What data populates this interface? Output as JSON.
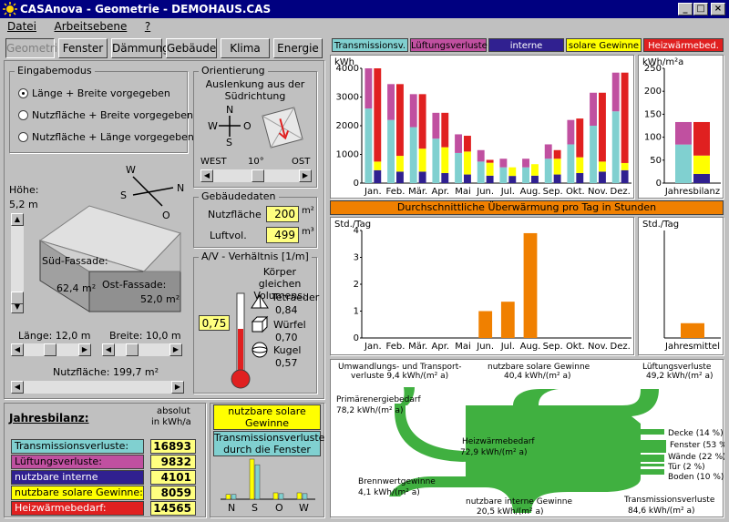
{
  "window": {
    "title": "CASAnova - Geometrie - DEMOHAUS.CAS"
  },
  "menu": [
    "Datei",
    "Arbeitsebene",
    "?"
  ],
  "tabs": [
    "Geometrie",
    "Fenster",
    "Dämmung",
    "Gebäude",
    "Klima",
    "Energie"
  ],
  "eingabemodus": {
    "label": "Eingabemodus",
    "options": [
      "Länge + Breite vorgegeben",
      "Nutzfläche + Breite  vorgegeben",
      "Nutzfläche + Länge vorgegeben"
    ],
    "selected": 0
  },
  "orientierung": {
    "label": "Orientierung",
    "text": "Auslenkung aus der Südrichtung",
    "compass": {
      "n": "N",
      "s": "S",
      "w": "W",
      "o": "O"
    },
    "west": "WEST",
    "value": "10°",
    "ost": "OST"
  },
  "gebaeudedaten": {
    "label": "Gebäudedaten",
    "nutzflaeche_label": "Nutzfläche",
    "nutzflaeche": "200",
    "nutzflaeche_unit": "m²",
    "luftvol_label": "Luftvol.",
    "luftvol": "499",
    "luftvol_unit": "m³"
  },
  "av": {
    "label": "A/V - Verhältnis [1/m]",
    "intro": "Körper gleichen Volumens:",
    "value": "0,75",
    "shapes": [
      {
        "name": "Tetraeder",
        "value": "0,84"
      },
      {
        "name": "Würfel",
        "value": "0,70"
      },
      {
        "name": "Kugel",
        "value": "0,57"
      }
    ],
    "fill_fraction": 0.55
  },
  "geometry": {
    "hoehe_label": "Höhe:",
    "hoehe": "5,2 m",
    "compass": {
      "w": "W",
      "s": "S",
      "n": "N",
      "o": "O"
    },
    "sued_fassade": "Süd-Fassade:",
    "sued_value": "62,4 m²",
    "ost_fassade": "Ost-Fassade:",
    "ost_value": "52,0 m²",
    "laenge": "Länge: 12,0 m",
    "breite": "Breite: 10,0 m",
    "nutzflaeche": "Nutzfläche: 199,7 m²"
  },
  "jahresbilanz": {
    "title": "Jahresbilanz:",
    "unit1": "absolut",
    "unit2": "in kWh/a",
    "rows": [
      {
        "label": "Transmissionsverluste:",
        "value": "16893",
        "color": "#80d0d0"
      },
      {
        "label": "Lüftungsverluste:",
        "value": "9832",
        "color": "#c050a0"
      },
      {
        "label": "nutzbare interne Gewinne:",
        "value": "4101",
        "color": "#302090"
      },
      {
        "label": "nutzbare solare Gewinne:",
        "value": "8059",
        "color": "#ffff00"
      },
      {
        "label": "Heizwärmebedarf:",
        "value": "14565",
        "color": "#e02020"
      }
    ]
  },
  "solar_panel": {
    "legend1": "nutzbare solare Gewinne",
    "legend2": "Transmissionsverluste durch die Fenster",
    "categories": [
      "N",
      "S",
      "O",
      "W"
    ],
    "solar": [
      0.12,
      1.0,
      0.16,
      0.16
    ],
    "trans": [
      0.12,
      0.86,
      0.14,
      0.14
    ]
  },
  "legend": [
    {
      "label": "Transmissionsv.",
      "color": "#80d0d0",
      "text": "#000000"
    },
    {
      "label": "Lüftungsverluste",
      "color": "#c050a0",
      "text": "#000000"
    },
    {
      "label": "interne Gewinne",
      "color": "#302090",
      "text": "#ffffff"
    },
    {
      "label": "solare Gewinne",
      "color": "#ffff00",
      "text": "#000000"
    },
    {
      "label": "Heizwärmebed.",
      "color": "#e02020",
      "text": "#ffffff"
    }
  ],
  "chart_data": [
    {
      "type": "bar",
      "ylabel": "kWh",
      "ylim": [
        0,
        4000
      ],
      "yticks": [
        "0",
        "1000",
        "2000",
        "3000",
        "4000"
      ],
      "categories": [
        "Jan.",
        "Feb.",
        "Mär.",
        "Apr.",
        "Mai",
        "Jun.",
        "Jul.",
        "Aug.",
        "Sep.",
        "Okt.",
        "Nov.",
        "Dez."
      ],
      "series": [
        {
          "name": "Transmissionsv.",
          "color": "#80d0d0",
          "values": [
            2600,
            2200,
            1950,
            1550,
            1050,
            750,
            550,
            550,
            850,
            1350,
            2000,
            2500
          ]
        },
        {
          "name": "Lüftungsverluste",
          "color": "#c050a0",
          "values": [
            1400,
            1250,
            1150,
            900,
            650,
            400,
            300,
            300,
            500,
            850,
            1150,
            1350
          ]
        },
        {
          "name": "interne Gewinne",
          "color": "#302090",
          "values": [
            450,
            400,
            400,
            350,
            300,
            260,
            250,
            260,
            300,
            350,
            400,
            450
          ]
        },
        {
          "name": "solare Gewinne",
          "color": "#ffff00",
          "values": [
            300,
            550,
            800,
            900,
            800,
            450,
            300,
            400,
            550,
            550,
            350,
            250
          ]
        },
        {
          "name": "Heizwärmebed.",
          "color": "#e02020",
          "values": [
            3250,
            2500,
            1900,
            1200,
            550,
            100,
            0,
            0,
            300,
            1350,
            2400,
            3150
          ]
        }
      ]
    },
    {
      "type": "bar",
      "ylabel": "kWh/m²a",
      "ylim": [
        0,
        250
      ],
      "yticks": [
        "0",
        "50",
        "100",
        "150",
        "200",
        "250"
      ],
      "categories": [
        "Jahresbilanz"
      ],
      "series": [
        {
          "name": "Transmissionsv.",
          "values": [
            84
          ]
        },
        {
          "name": "Lüftungsverluste",
          "values": [
            49
          ]
        },
        {
          "name": "interne Gewinne",
          "values": [
            20
          ]
        },
        {
          "name": "solare Gewinne",
          "values": [
            40
          ]
        },
        {
          "name": "Heizwärmebed.",
          "values": [
            73
          ]
        }
      ]
    },
    {
      "type": "bar",
      "title": "Durchschnittliche Überwärmung pro Tag in Stunden",
      "ylabel": "Std./Tag",
      "ylim": [
        0,
        4
      ],
      "yticks": [
        "0",
        "1",
        "2",
        "3",
        "4"
      ],
      "categories": [
        "Jan.",
        "Feb.",
        "Mär.",
        "Apr.",
        "Mai",
        "Jun.",
        "Jul.",
        "Aug.",
        "Sep.",
        "Okt.",
        "Nov.",
        "Dez."
      ],
      "values": [
        0,
        0,
        0,
        0,
        0,
        1.0,
        1.35,
        3.9,
        0,
        0,
        0,
        0
      ],
      "color": "#f08000"
    },
    {
      "type": "bar",
      "ylabel": "Std./Tag",
      "ylim": [
        0,
        4
      ],
      "categories": [
        "Jahresmittel"
      ],
      "values": [
        0.55
      ],
      "color": "#f08000"
    }
  ],
  "sankey": {
    "umwandlung": "Umwandlungs- und Transport-verluste 9,4 kWh/(m² a)",
    "solar": "nutzbare solare Gewinne",
    "solar_value": "40,4 kWh/(m² a)",
    "lueftung": "Lüftungsverluste",
    "lueftung_value": "49,2 kWh/(m² a)",
    "primaer": "Primärenergiebedarf",
    "primaer_value": "78,2 kWh/(m² a)",
    "heiz": "Heizwärmebedarf",
    "heiz_value": "72,9 kWh/(m² a)",
    "brenn": "Brennwertgewinne",
    "brenn_value": "4,1 kWh/(m² a)",
    "intern": "nutzbare interne Gewinne",
    "intern_value": "20,5 kWh/(m² a)",
    "trans": "Transmissionsverluste",
    "trans_value": "84,6 kWh/(m² a)",
    "outputs": [
      "Decke (14 %)",
      "Fenster (53 %)",
      "Wände (22 %)",
      "Tür (2 %)",
      "Boden (10 %)"
    ]
  }
}
